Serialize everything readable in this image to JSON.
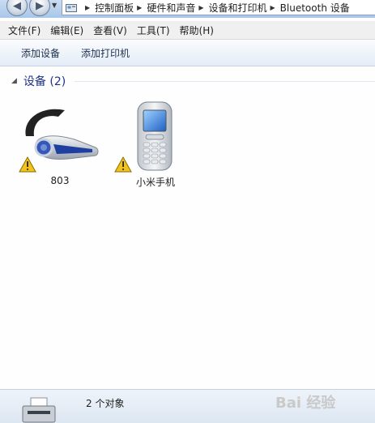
{
  "address": {
    "crumbs": [
      "控制面板",
      "硬件和声音",
      "设备和打印机",
      "Bluetooth 设备"
    ]
  },
  "menu": {
    "items": [
      "文件(F)",
      "编辑(E)",
      "查看(V)",
      "工具(T)",
      "帮助(H)"
    ]
  },
  "toolbar": {
    "add_device": "添加设备",
    "add_printer": "添加打印机"
  },
  "group": {
    "title": "设备 (2)"
  },
  "devices": [
    {
      "name": "803",
      "icon": "headset-icon",
      "warning": true
    },
    {
      "name": "小米手机",
      "icon": "mobile-phone-icon",
      "warning": true
    }
  ],
  "status": {
    "count": "2 个对象"
  },
  "watermark": "Bai 经验"
}
